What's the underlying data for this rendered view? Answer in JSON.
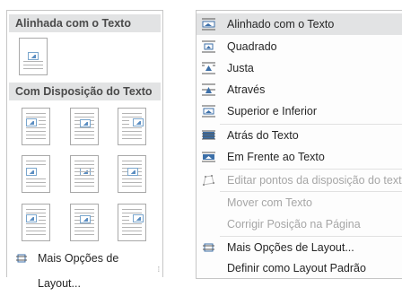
{
  "gallery": {
    "inline_header": "Alinhada com o Texto",
    "wrap_header": "Com Disposição do Texto",
    "more_options": "Mais Opções de Layout...",
    "grip": "⁞"
  },
  "menu": {
    "items": [
      {
        "label": "Alinhado com o Texto",
        "icon": "inline-with-text-icon",
        "state": "selected"
      },
      {
        "label": "Quadrado",
        "icon": "wrap-square-icon",
        "state": "normal"
      },
      {
        "label": "Justa",
        "icon": "wrap-tight-icon",
        "state": "normal"
      },
      {
        "label": "Através",
        "icon": "wrap-through-icon",
        "state": "normal"
      },
      {
        "label": "Superior e Inferior",
        "icon": "wrap-top-bottom-icon",
        "state": "normal"
      },
      {
        "label": "Atrás do Texto",
        "icon": "behind-text-icon",
        "state": "normal"
      },
      {
        "label": "Em Frente ao Texto",
        "icon": "in-front-of-text-icon",
        "state": "normal"
      },
      {
        "label": "Editar pontos da disposição do texto",
        "icon": "edit-wrap-points-icon",
        "state": "disabled"
      },
      {
        "label": "Mover com Texto",
        "icon": "",
        "state": "disabled"
      },
      {
        "label": "Corrigir Posição na Página",
        "icon": "",
        "state": "disabled"
      },
      {
        "label": "Mais Opções de Layout...",
        "icon": "layout-options-icon",
        "state": "normal"
      },
      {
        "label": "Definir como Layout Padrão",
        "icon": "",
        "state": "normal"
      }
    ]
  },
  "colors": {
    "accent": "#3c6fa8",
    "selected_bg": "#e2e3e4",
    "disabled_text": "#a6a6a6"
  }
}
